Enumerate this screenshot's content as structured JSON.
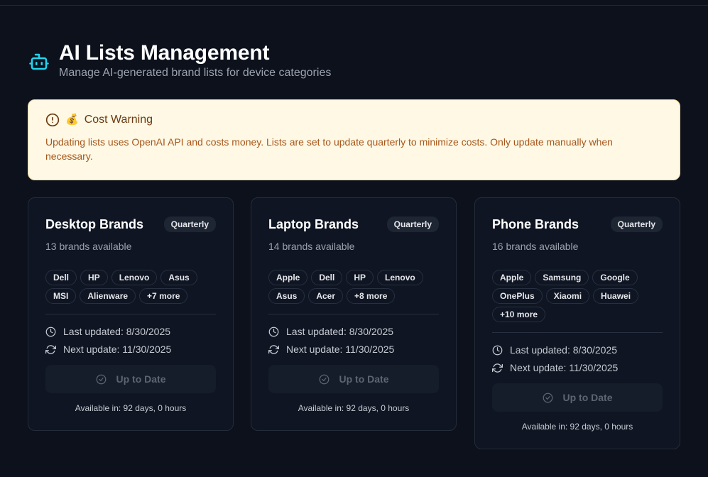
{
  "header": {
    "title": "AI Lists Management",
    "subtitle": "Manage AI-generated brand lists for device categories"
  },
  "warning": {
    "emoji": "💰",
    "title": "Cost Warning",
    "text": "Updating lists uses OpenAI API and costs money. Lists are set to update quarterly to minimize costs. Only update manually when necessary."
  },
  "cards": [
    {
      "title": "Desktop Brands",
      "badge": "Quarterly",
      "count": "13 brands available",
      "brands": [
        "Dell",
        "HP",
        "Lenovo",
        "Asus",
        "MSI",
        "Alienware",
        "+7 more"
      ],
      "last_updated": "Last updated: 8/30/2025",
      "next_update": "Next update: 11/30/2025",
      "button": "Up to Date",
      "available": "Available in: 92 days, 0 hours"
    },
    {
      "title": "Laptop Brands",
      "badge": "Quarterly",
      "count": "14 brands available",
      "brands": [
        "Apple",
        "Dell",
        "HP",
        "Lenovo",
        "Asus",
        "Acer",
        "+8 more"
      ],
      "last_updated": "Last updated: 8/30/2025",
      "next_update": "Next update: 11/30/2025",
      "button": "Up to Date",
      "available": "Available in: 92 days, 0 hours"
    },
    {
      "title": "Phone Brands",
      "badge": "Quarterly",
      "count": "16 brands available",
      "brands": [
        "Apple",
        "Samsung",
        "Google",
        "OnePlus",
        "Xiaomi",
        "Huawei",
        "+10 more"
      ],
      "last_updated": "Last updated: 8/30/2025",
      "next_update": "Next update: 11/30/2025",
      "button": "Up to Date",
      "available": "Available in: 92 days, 0 hours"
    }
  ],
  "icons": {
    "header": "robot-icon",
    "warning": "alert-circle-icon",
    "last_updated": "clock-icon",
    "next_update": "refresh-icon",
    "button": "check-circle-icon"
  },
  "colors": {
    "background": "#0c111c",
    "accent": "#22d3ee",
    "warning_bg": "#fef8e4",
    "warning_text": "#a8561b"
  }
}
